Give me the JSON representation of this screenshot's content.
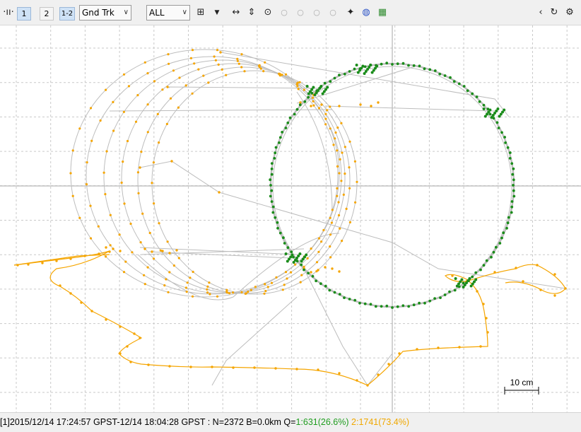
{
  "toolbar": {
    "btn1": "1",
    "btn2": "2",
    "btn12": "1-2",
    "plot_type": "Gnd Trk",
    "sat_filter": "ALL"
  },
  "plot": {
    "scale_label": "10 cm",
    "colors": {
      "q1": "#1a8c1a",
      "q2": "#f5a500",
      "track_line": "#bdbdbd",
      "grid": "#c9c9c9",
      "axis": "#a6a6a6"
    }
  },
  "status": {
    "prefix": "[1]2015/12/14 17:24:57 GPST-12/14 18:04:28 GPST : N=2372 B=0.0km Q=",
    "q1": "1:631(26.6%)",
    "q2": "2:1741(73.4%)"
  }
}
